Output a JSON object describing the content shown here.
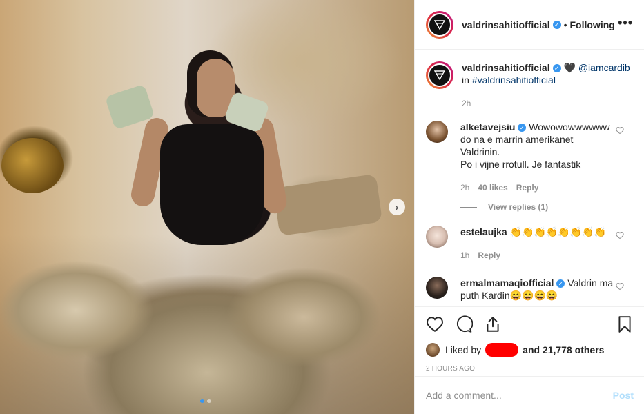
{
  "post": {
    "username": "valdrinsahitiofficial",
    "following": "Following",
    "separator": "•",
    "more": "•••"
  },
  "caption": {
    "username": "valdrinsahitiofficial",
    "heart": "🖤",
    "mention": "@iamcardib",
    "in_label": "in",
    "hashtag": "#valdrinsahitiofficial",
    "time": "2h"
  },
  "comments": [
    {
      "username": "alketavejsiu",
      "verified": true,
      "text_line1": "Wowowowwwwww do na e marrin amerikanet Valdrinin.",
      "text_line2": "Po i vijne rrotull. Je fantastik",
      "time": "2h",
      "likes": "40 likes",
      "reply": "Reply",
      "view_replies": "View replies (1)"
    },
    {
      "username": "estelaujka",
      "verified": false,
      "text": "👏👏👏👏👏👏👏👏",
      "time": "1h",
      "reply": "Reply"
    },
    {
      "username": "ermalmamaqiofficial",
      "verified": true,
      "text": "Valdrin ma puth Kardin😄😄😄😄"
    }
  ],
  "likes": {
    "prefix": "Liked by",
    "suffix": "and 21,778 others"
  },
  "timestamp": "2 HOURS AGO",
  "add_comment": {
    "placeholder": "Add a comment...",
    "post": "Post"
  },
  "carousel": {
    "next": "›",
    "dots": 2,
    "active": 0
  },
  "colors": {
    "verified": "#3897f0",
    "link": "#003569",
    "muted": "#8e8e8e",
    "post_disabled": "#b2dffc",
    "redaction": "#ff0000"
  }
}
